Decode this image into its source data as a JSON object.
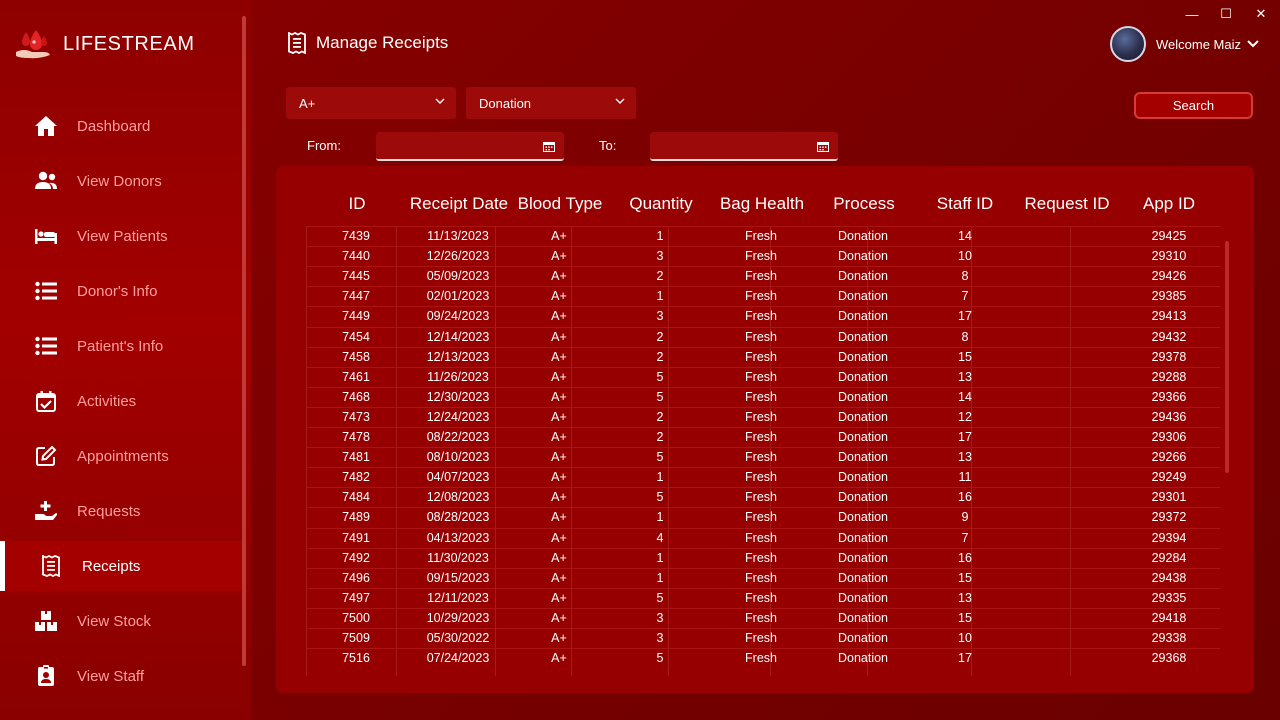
{
  "app": {
    "name": "LIFESTREAM"
  },
  "colors": {
    "sidebar": "#a20000",
    "main": "#7a0000",
    "panel": "#960000",
    "accent": "#ff9e9e",
    "active": "#ffffff"
  },
  "sidebar": {
    "items": [
      {
        "label": "Dashboard",
        "icon": "home-icon"
      },
      {
        "label": "View Donors",
        "icon": "users-icon"
      },
      {
        "label": "View Patients",
        "icon": "bed-icon"
      },
      {
        "label": "Donor's Info",
        "icon": "list-icon"
      },
      {
        "label": "Patient's Info",
        "icon": "list-icon"
      },
      {
        "label": "Activities",
        "icon": "calendar-check-icon"
      },
      {
        "label": "Appointments",
        "icon": "edit-icon"
      },
      {
        "label": "Requests",
        "icon": "hand-plus-icon"
      },
      {
        "label": "Receipts",
        "icon": "receipt-icon",
        "active": true
      },
      {
        "label": "View Stock",
        "icon": "boxes-icon"
      },
      {
        "label": "View Staff",
        "icon": "id-badge-icon"
      }
    ]
  },
  "header": {
    "title": "Manage Receipts",
    "welcome": "Welcome Maiz"
  },
  "window": {
    "minimize": "—",
    "maximize": "☐",
    "close": "✕"
  },
  "filters": {
    "blood_type": "A+",
    "process": "Donation",
    "search_label": "Search",
    "from_label": "From:",
    "to_label": "To:",
    "from_value": "",
    "to_value": ""
  },
  "table": {
    "columns": [
      "ID",
      "Receipt Date",
      "Blood Type",
      "Quantity",
      "Bag Health",
      "Process",
      "Staff ID",
      "Request ID",
      "App ID"
    ],
    "rows": [
      [
        "7439",
        "11/13/2023",
        "A+",
        "1",
        "Fresh",
        "Donation",
        "14",
        "",
        "29425"
      ],
      [
        "7440",
        "12/26/2023",
        "A+",
        "3",
        "Fresh",
        "Donation",
        "10",
        "",
        "29310"
      ],
      [
        "7445",
        "05/09/2023",
        "A+",
        "2",
        "Fresh",
        "Donation",
        "8",
        "",
        "29426"
      ],
      [
        "7447",
        "02/01/2023",
        "A+",
        "1",
        "Fresh",
        "Donation",
        "7",
        "",
        "29385"
      ],
      [
        "7449",
        "09/24/2023",
        "A+",
        "3",
        "Fresh",
        "Donation",
        "17",
        "",
        "29413"
      ],
      [
        "7454",
        "12/14/2023",
        "A+",
        "2",
        "Fresh",
        "Donation",
        "8",
        "",
        "29432"
      ],
      [
        "7458",
        "12/13/2023",
        "A+",
        "2",
        "Fresh",
        "Donation",
        "15",
        "",
        "29378"
      ],
      [
        "7461",
        "11/26/2023",
        "A+",
        "5",
        "Fresh",
        "Donation",
        "13",
        "",
        "29288"
      ],
      [
        "7468",
        "12/30/2023",
        "A+",
        "5",
        "Fresh",
        "Donation",
        "14",
        "",
        "29366"
      ],
      [
        "7473",
        "12/24/2023",
        "A+",
        "2",
        "Fresh",
        "Donation",
        "12",
        "",
        "29436"
      ],
      [
        "7478",
        "08/22/2023",
        "A+",
        "2",
        "Fresh",
        "Donation",
        "17",
        "",
        "29306"
      ],
      [
        "7481",
        "08/10/2023",
        "A+",
        "5",
        "Fresh",
        "Donation",
        "13",
        "",
        "29266"
      ],
      [
        "7482",
        "04/07/2023",
        "A+",
        "1",
        "Fresh",
        "Donation",
        "11",
        "",
        "29249"
      ],
      [
        "7484",
        "12/08/2023",
        "A+",
        "5",
        "Fresh",
        "Donation",
        "16",
        "",
        "29301"
      ],
      [
        "7489",
        "08/28/2023",
        "A+",
        "1",
        "Fresh",
        "Donation",
        "9",
        "",
        "29372"
      ],
      [
        "7491",
        "04/13/2023",
        "A+",
        "4",
        "Fresh",
        "Donation",
        "7",
        "",
        "29394"
      ],
      [
        "7492",
        "11/30/2023",
        "A+",
        "1",
        "Fresh",
        "Donation",
        "16",
        "",
        "29284"
      ],
      [
        "7496",
        "09/15/2023",
        "A+",
        "1",
        "Fresh",
        "Donation",
        "15",
        "",
        "29438"
      ],
      [
        "7497",
        "12/11/2023",
        "A+",
        "5",
        "Fresh",
        "Donation",
        "13",
        "",
        "29335"
      ],
      [
        "7500",
        "10/29/2023",
        "A+",
        "3",
        "Fresh",
        "Donation",
        "15",
        "",
        "29418"
      ],
      [
        "7509",
        "05/30/2022",
        "A+",
        "3",
        "Fresh",
        "Donation",
        "10",
        "",
        "29338"
      ],
      [
        "7516",
        "07/24/2023",
        "A+",
        "5",
        "Fresh",
        "Donation",
        "17",
        "",
        "29368"
      ]
    ]
  }
}
